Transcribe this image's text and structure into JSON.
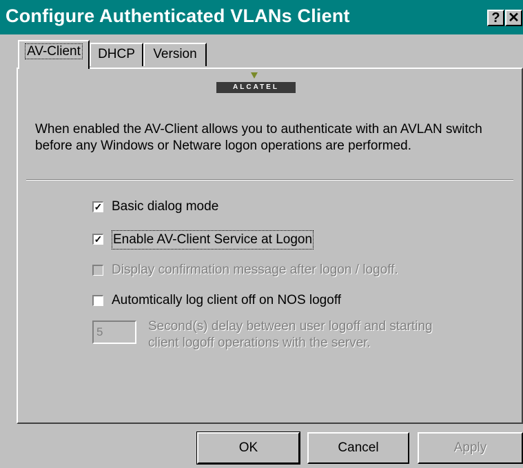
{
  "window": {
    "title": "Configure Authenticated VLANs Client",
    "help_glyph": "?",
    "close_glyph": "✕"
  },
  "tabs": [
    {
      "label": "AV-Client",
      "active": true
    },
    {
      "label": "DHCP",
      "active": false
    },
    {
      "label": "Version",
      "active": false
    }
  ],
  "logo": {
    "text": "ALCATEL"
  },
  "description": "When enabled the AV-Client allows you to authenticate with an AVLAN switch before any Windows or Netware logon operations are performed.",
  "options": [
    {
      "label": "Basic dialog mode",
      "checked": true,
      "enabled": true
    },
    {
      "label": "Enable AV-Client Service at Logon",
      "checked": true,
      "enabled": true
    },
    {
      "label": "Display confirmation message after logon / logoff.",
      "checked": false,
      "enabled": false
    },
    {
      "label": "Automtically log client off on NOS logoff",
      "checked": false,
      "enabled": true
    }
  ],
  "delay": {
    "value": "5",
    "text": "Second(s) delay between user logoff and starting client logoff operations with the server."
  },
  "buttons": {
    "ok": "OK",
    "cancel": "Cancel",
    "apply": "Apply"
  },
  "check_glyph": "✓",
  "colors": {
    "title_bar": "#008080",
    "dialog_face": "#c0c0c0",
    "disabled_text": "#808080"
  }
}
